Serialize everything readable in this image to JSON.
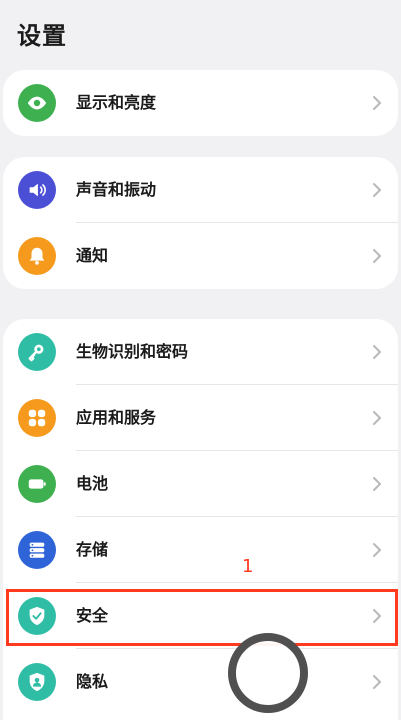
{
  "header": {
    "title": "设置"
  },
  "groups": [
    {
      "items": [
        {
          "label": "显示和亮度",
          "icon": "eye-icon",
          "color": "#3fb04f"
        }
      ]
    },
    {
      "items": [
        {
          "label": "声音和振动",
          "icon": "speaker-icon",
          "color": "#4b4fd6"
        },
        {
          "label": "通知",
          "icon": "bell-icon",
          "color": "#f59a1c"
        }
      ]
    },
    {
      "items": [
        {
          "label": "生物识别和密码",
          "icon": "key-icon",
          "color": "#2fbda6"
        },
        {
          "label": "应用和服务",
          "icon": "apps-grid-icon",
          "color": "#f59a1c"
        },
        {
          "label": "电池",
          "icon": "battery-icon",
          "color": "#3fb04f"
        },
        {
          "label": "存储",
          "icon": "storage-icon",
          "color": "#2f63d8"
        },
        {
          "label": "安全",
          "icon": "shield-check-icon",
          "color": "#2fbda6"
        },
        {
          "label": "隐私",
          "icon": "privacy-shield-icon",
          "color": "#2fbda6"
        }
      ]
    }
  ],
  "annotation": {
    "number": "1",
    "color": "#ff3a1f"
  }
}
